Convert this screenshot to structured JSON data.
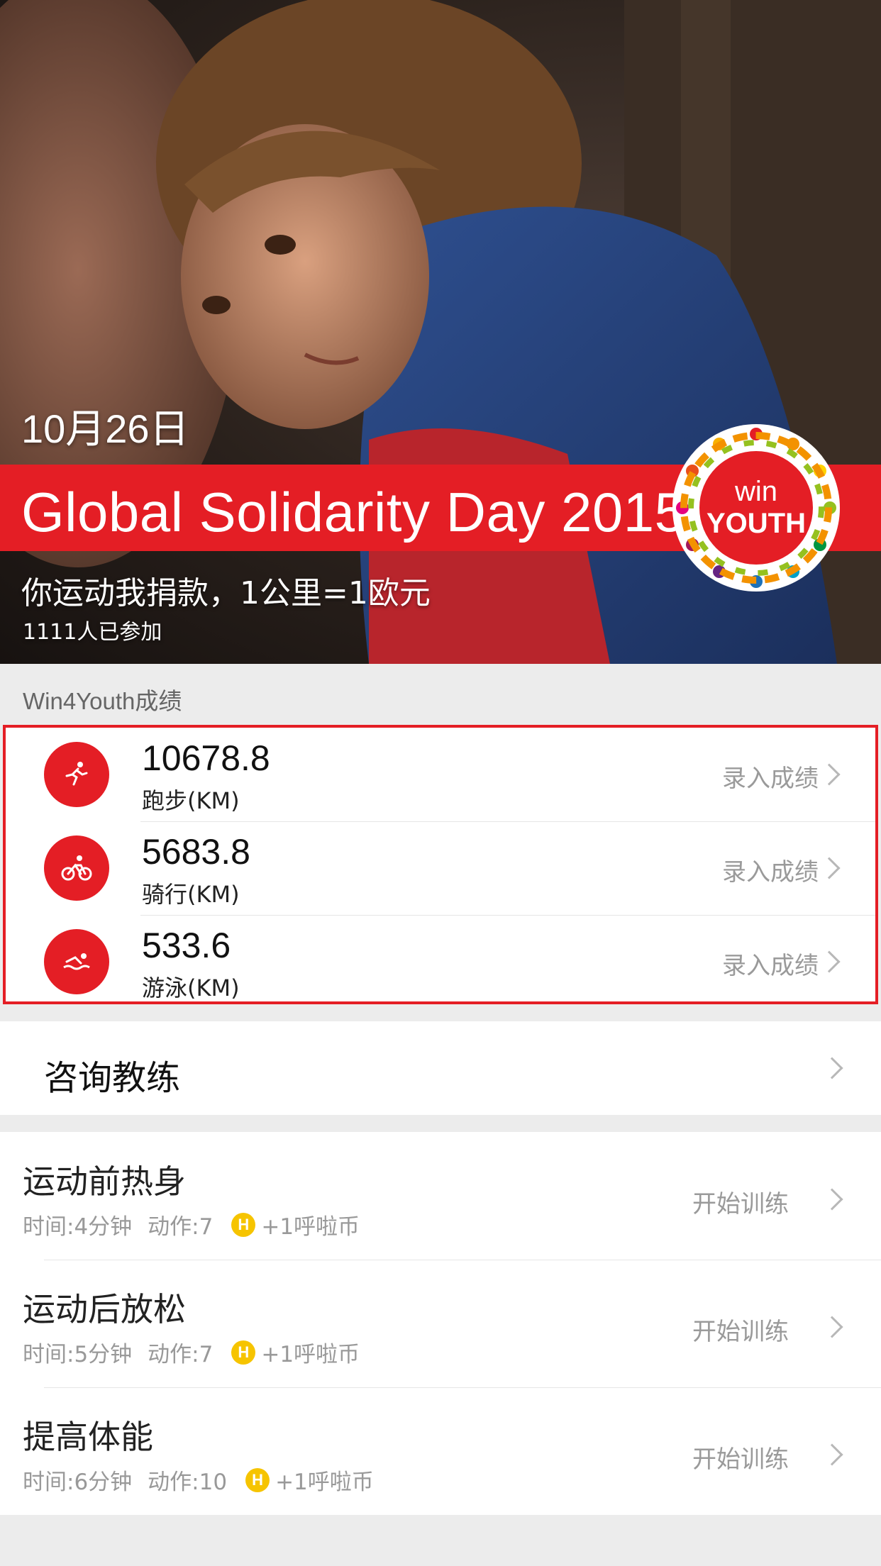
{
  "hero": {
    "date": "10月26日",
    "banner_title": "Global Solidarity Day 2015",
    "logo_text_top": "win",
    "logo_text_bottom": "YOUTH",
    "slogan": "你运动我捐款，1公里=1欧元",
    "participants": "1111人已参加"
  },
  "results": {
    "section_label": "Win4Youth成绩",
    "items": [
      {
        "value": "10678.8",
        "unit": "跑步(KM)",
        "action": "录入成绩",
        "icon": "running-icon"
      },
      {
        "value": "5683.8",
        "unit": "骑行(KM)",
        "action": "录入成绩",
        "icon": "cycling-icon"
      },
      {
        "value": "533.6",
        "unit": "游泳(KM)",
        "action": "录入成绩",
        "icon": "swimming-icon"
      }
    ]
  },
  "consult": {
    "label": "咨询教练"
  },
  "training": {
    "items": [
      {
        "title": "运动前热身",
        "time": "时间:4分钟",
        "actions": "动作:7",
        "coin_glyph": "H",
        "reward": "+1呼啦币",
        "action": "开始训练"
      },
      {
        "title": "运动后放松",
        "time": "时间:5分钟",
        "actions": "动作:7",
        "coin_glyph": "H",
        "reward": "+1呼啦币",
        "action": "开始训练"
      },
      {
        "title": "提高体能",
        "time": "时间:6分钟",
        "actions": "动作:10",
        "coin_glyph": "H",
        "reward": "+1呼啦币",
        "action": "开始训练"
      }
    ]
  },
  "colors": {
    "accent": "#e41e25",
    "coin": "#f6c400",
    "muted_text": "#9a9a9a"
  }
}
